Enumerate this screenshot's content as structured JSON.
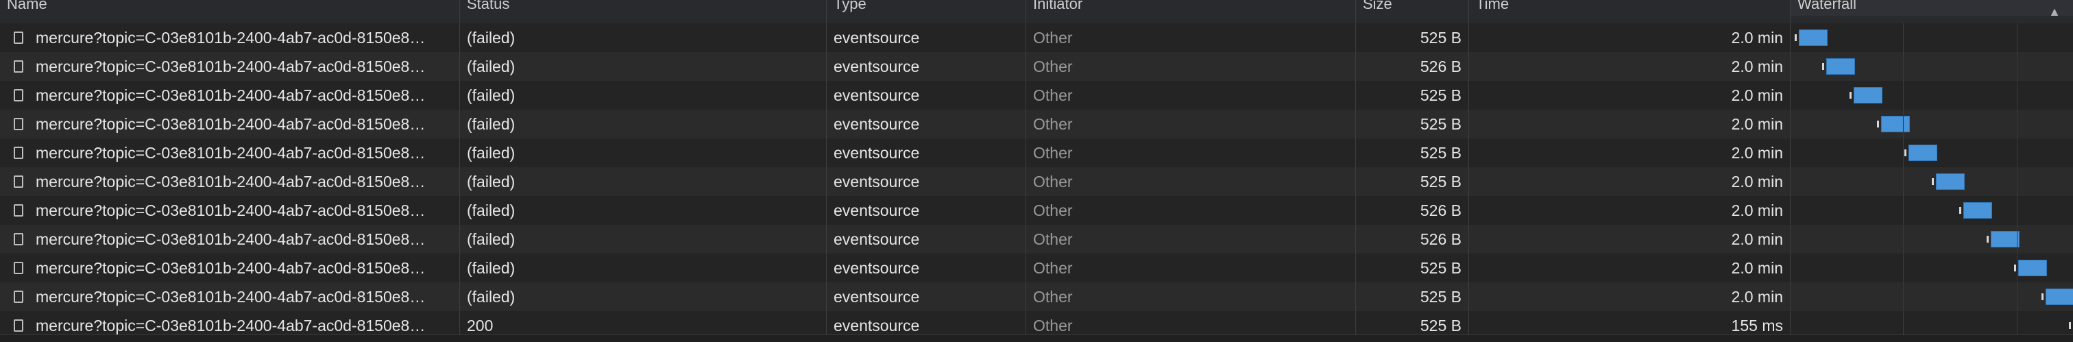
{
  "header": {
    "columns": [
      {
        "key": "name",
        "label": "Name"
      },
      {
        "key": "status",
        "label": "Status"
      },
      {
        "key": "type",
        "label": "Type"
      },
      {
        "key": "initiator",
        "label": "Initiator"
      },
      {
        "key": "size",
        "label": "Size"
      },
      {
        "key": "time",
        "label": "Time"
      },
      {
        "key": "waterfall",
        "label": "Waterfall"
      }
    ],
    "sort_indicator": "▲"
  },
  "rows": [
    {
      "name": "mercure?topic=C-03e8101b-2400-4ab7-ac0d-8150e8…",
      "status": "(failed)",
      "type": "eventsource",
      "initiator": "Other",
      "size": "525 B",
      "time": "2.0 min"
    },
    {
      "name": "mercure?topic=C-03e8101b-2400-4ab7-ac0d-8150e8…",
      "status": "(failed)",
      "type": "eventsource",
      "initiator": "Other",
      "size": "526 B",
      "time": "2.0 min"
    },
    {
      "name": "mercure?topic=C-03e8101b-2400-4ab7-ac0d-8150e8…",
      "status": "(failed)",
      "type": "eventsource",
      "initiator": "Other",
      "size": "525 B",
      "time": "2.0 min"
    },
    {
      "name": "mercure?topic=C-03e8101b-2400-4ab7-ac0d-8150e8…",
      "status": "(failed)",
      "type": "eventsource",
      "initiator": "Other",
      "size": "525 B",
      "time": "2.0 min"
    },
    {
      "name": "mercure?topic=C-03e8101b-2400-4ab7-ac0d-8150e8…",
      "status": "(failed)",
      "type": "eventsource",
      "initiator": "Other",
      "size": "525 B",
      "time": "2.0 min"
    },
    {
      "name": "mercure?topic=C-03e8101b-2400-4ab7-ac0d-8150e8…",
      "status": "(failed)",
      "type": "eventsource",
      "initiator": "Other",
      "size": "525 B",
      "time": "2.0 min"
    },
    {
      "name": "mercure?topic=C-03e8101b-2400-4ab7-ac0d-8150e8…",
      "status": "(failed)",
      "type": "eventsource",
      "initiator": "Other",
      "size": "526 B",
      "time": "2.0 min"
    },
    {
      "name": "mercure?topic=C-03e8101b-2400-4ab7-ac0d-8150e8…",
      "status": "(failed)",
      "type": "eventsource",
      "initiator": "Other",
      "size": "526 B",
      "time": "2.0 min"
    },
    {
      "name": "mercure?topic=C-03e8101b-2400-4ab7-ac0d-8150e8…",
      "status": "(failed)",
      "type": "eventsource",
      "initiator": "Other",
      "size": "525 B",
      "time": "2.0 min"
    },
    {
      "name": "mercure?topic=C-03e8101b-2400-4ab7-ac0d-8150e8…",
      "status": "(failed)",
      "type": "eventsource",
      "initiator": "Other",
      "size": "525 B",
      "time": "2.0 min"
    },
    {
      "name": "mercure?topic=C-03e8101b-2400-4ab7-ac0d-8150e8…",
      "status": "200",
      "type": "eventsource",
      "initiator": "Other",
      "size": "525 B",
      "time": "155 ms"
    }
  ],
  "icons": {
    "row_icon": "document-icon",
    "sort_icon": "sort-ascending-icon"
  },
  "colors": {
    "bar": "#4a95da",
    "background": "#242424",
    "row_alt": "#2b2b2b"
  }
}
